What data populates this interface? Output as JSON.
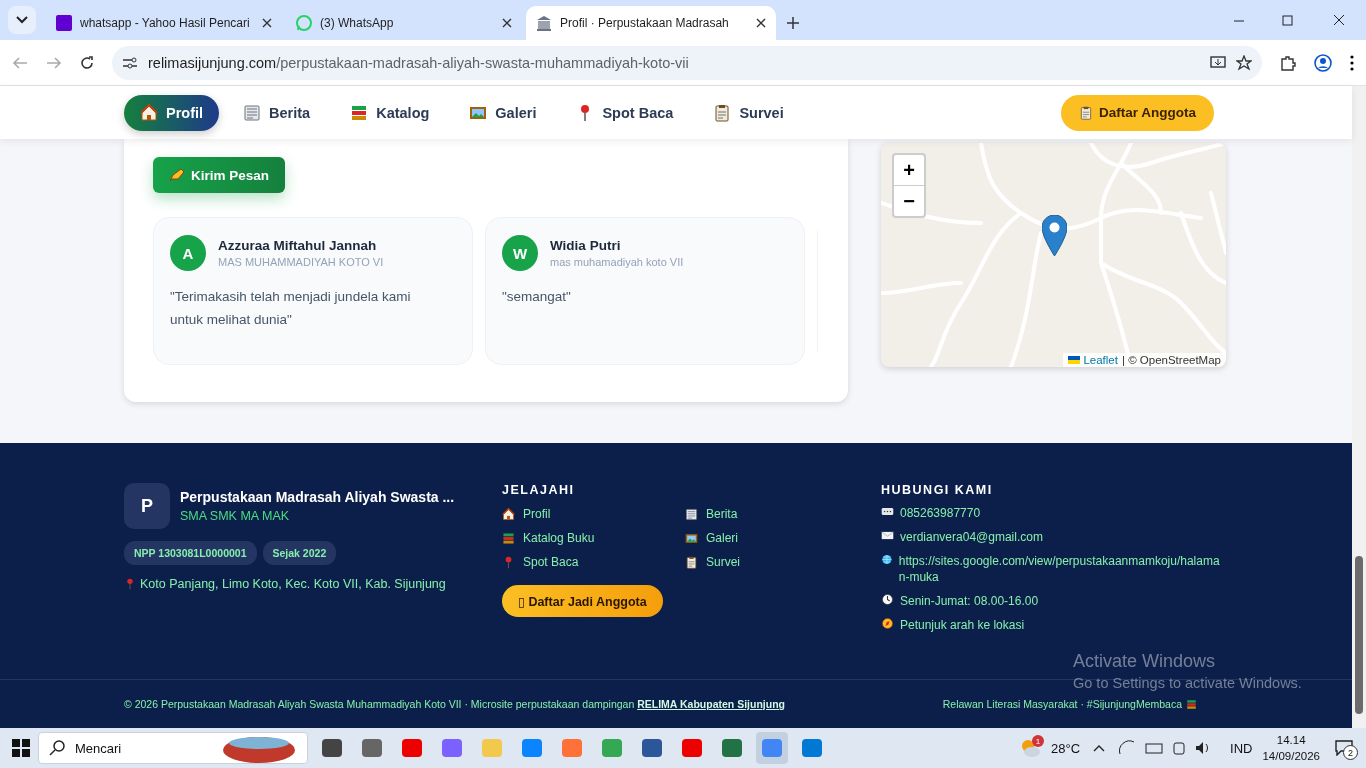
{
  "browser": {
    "tabs": [
      {
        "kind": "yahoo",
        "title": "whatsapp - Yahoo Hasil Pencari",
        "selected": false
      },
      {
        "kind": "whatsapp",
        "title": "(3) WhatsApp",
        "selected": false
      },
      {
        "kind": "library",
        "title": "Profil · Perpustakaan Madrasah",
        "selected": true
      }
    ],
    "url_host": "relimasijunjung.com",
    "url_path": "/perpustakaan-madrasah-aliyah-swasta-muhammadiyah-koto-vii"
  },
  "nav": {
    "items": [
      {
        "kind": "home",
        "label": "Profil",
        "selected": true
      },
      {
        "kind": "news",
        "label": "Berita",
        "selected": false
      },
      {
        "kind": "books",
        "label": "Katalog",
        "selected": false
      },
      {
        "kind": "picture",
        "label": "Galeri",
        "selected": false
      },
      {
        "kind": "pin",
        "label": "Spot Baca",
        "selected": false
      },
      {
        "kind": "clipboard",
        "label": "Survei",
        "selected": false
      }
    ],
    "cta": "Daftar Anggota"
  },
  "messages": {
    "button": "Kirim Pesan",
    "testimonials": [
      {
        "initial": "A",
        "name": "Azzuraa Miftahul Jannah",
        "school": "MAS MUHAMMADIYAH KOTO VI",
        "quote": "\"Terimakasih telah menjadi jundela kami untuk melihat dunia\""
      },
      {
        "initial": "W",
        "name": "Widia Putri",
        "school": "mas muhamadiyah koto VII",
        "quote": "\"semangat\""
      }
    ]
  },
  "map": {
    "zoom_in": "+",
    "zoom_out": "−",
    "attribution_link": "Leaflet",
    "attribution": "| © OpenStreetMap"
  },
  "footer": {
    "brand": {
      "initial": "P",
      "name": "Perpustakaan Madrasah Aliyah Swasta ...",
      "subtitle": "SMA SMK MA MAK"
    },
    "badges": [
      "NPP 1303081L0000001",
      "Sejak 2022"
    ],
    "address": "Koto Panjang, Limo Koto, Kec. Koto VII, Kab. Sijunjung",
    "explore": {
      "title": "JELAJAHI",
      "links": [
        {
          "kind": "home",
          "label": "Profil"
        },
        {
          "kind": "news",
          "label": "Berita"
        },
        {
          "kind": "books",
          "label": "Katalog Buku"
        },
        {
          "kind": "picture",
          "label": "Galeri"
        },
        {
          "kind": "pin",
          "label": "Spot Baca"
        },
        {
          "kind": "clipboard",
          "label": "Survei"
        }
      ],
      "cta_icon": "▯",
      "cta": "Daftar Jadi Anggota"
    },
    "contact": {
      "title": "HUBUNGI KAMI",
      "items": [
        {
          "kind": "chat",
          "text": "085263987770"
        },
        {
          "kind": "mail",
          "text": "verdianvera04@gmail.com"
        },
        {
          "kind": "globe",
          "text": "https://sites.google.com/view/perpustakaanmamkoju/halaman-muka"
        },
        {
          "kind": "clock",
          "text": "Senin-Jumat: 08.00-16.00"
        },
        {
          "kind": "compass",
          "text": "Petunjuk arah ke lokasi"
        }
      ]
    },
    "copyright": "© 2026 Perpustakaan Madrasah Aliyah Swasta Muhammadiyah Koto VII · Microsite perpustakaan dampingan ",
    "copyright_link": "RELIMA Kabupaten Sijunjung",
    "tagline": "Relawan Literasi Masyarakat · #SijunjungMembaca"
  },
  "watermark": {
    "title": "Activate Windows",
    "subtitle": "Go to Settings to activate Windows."
  },
  "taskbar": {
    "search": "Mencari",
    "weather": "28°C",
    "weather_alert": "1",
    "language": "IND",
    "time": "14.14",
    "date": "14/09/2026",
    "notifications": "2"
  }
}
